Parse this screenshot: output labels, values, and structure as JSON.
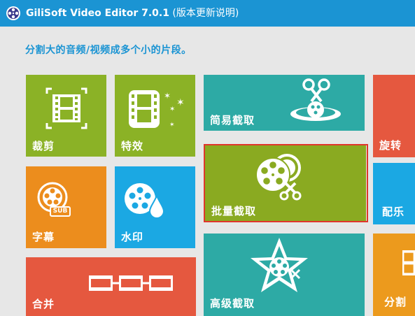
{
  "window": {
    "app_name": "GiliSoft Video Editor 7.0.1",
    "title_suffix": " (版本更新说明)"
  },
  "header": {
    "subtitle": "分割大的音频/视频成多个小的片段。"
  },
  "tiles": {
    "crop": {
      "label": "裁剪",
      "color": "#8bb226"
    },
    "effects": {
      "label": "特效",
      "color": "#8bb226"
    },
    "simple_cut": {
      "label": "简易截取",
      "color": "#2daaa5"
    },
    "rotate": {
      "label": "旋转",
      "color": "#e5583f"
    },
    "subtitle": {
      "label": "字幕",
      "color": "#ec8d1d",
      "badge": "SUB"
    },
    "watermark": {
      "label": "水印",
      "color": "#1ba8e3"
    },
    "batch_cut": {
      "label": "批量截取",
      "color": "#8aaa21"
    },
    "music": {
      "label": "配乐",
      "color": "#1ba8e3"
    },
    "merge": {
      "label": "合并",
      "color": "#e5583f"
    },
    "advanced_cut": {
      "label": "高级截取",
      "color": "#2daaa5"
    },
    "split": {
      "label": "分割",
      "color": "#ec9a1d"
    }
  }
}
